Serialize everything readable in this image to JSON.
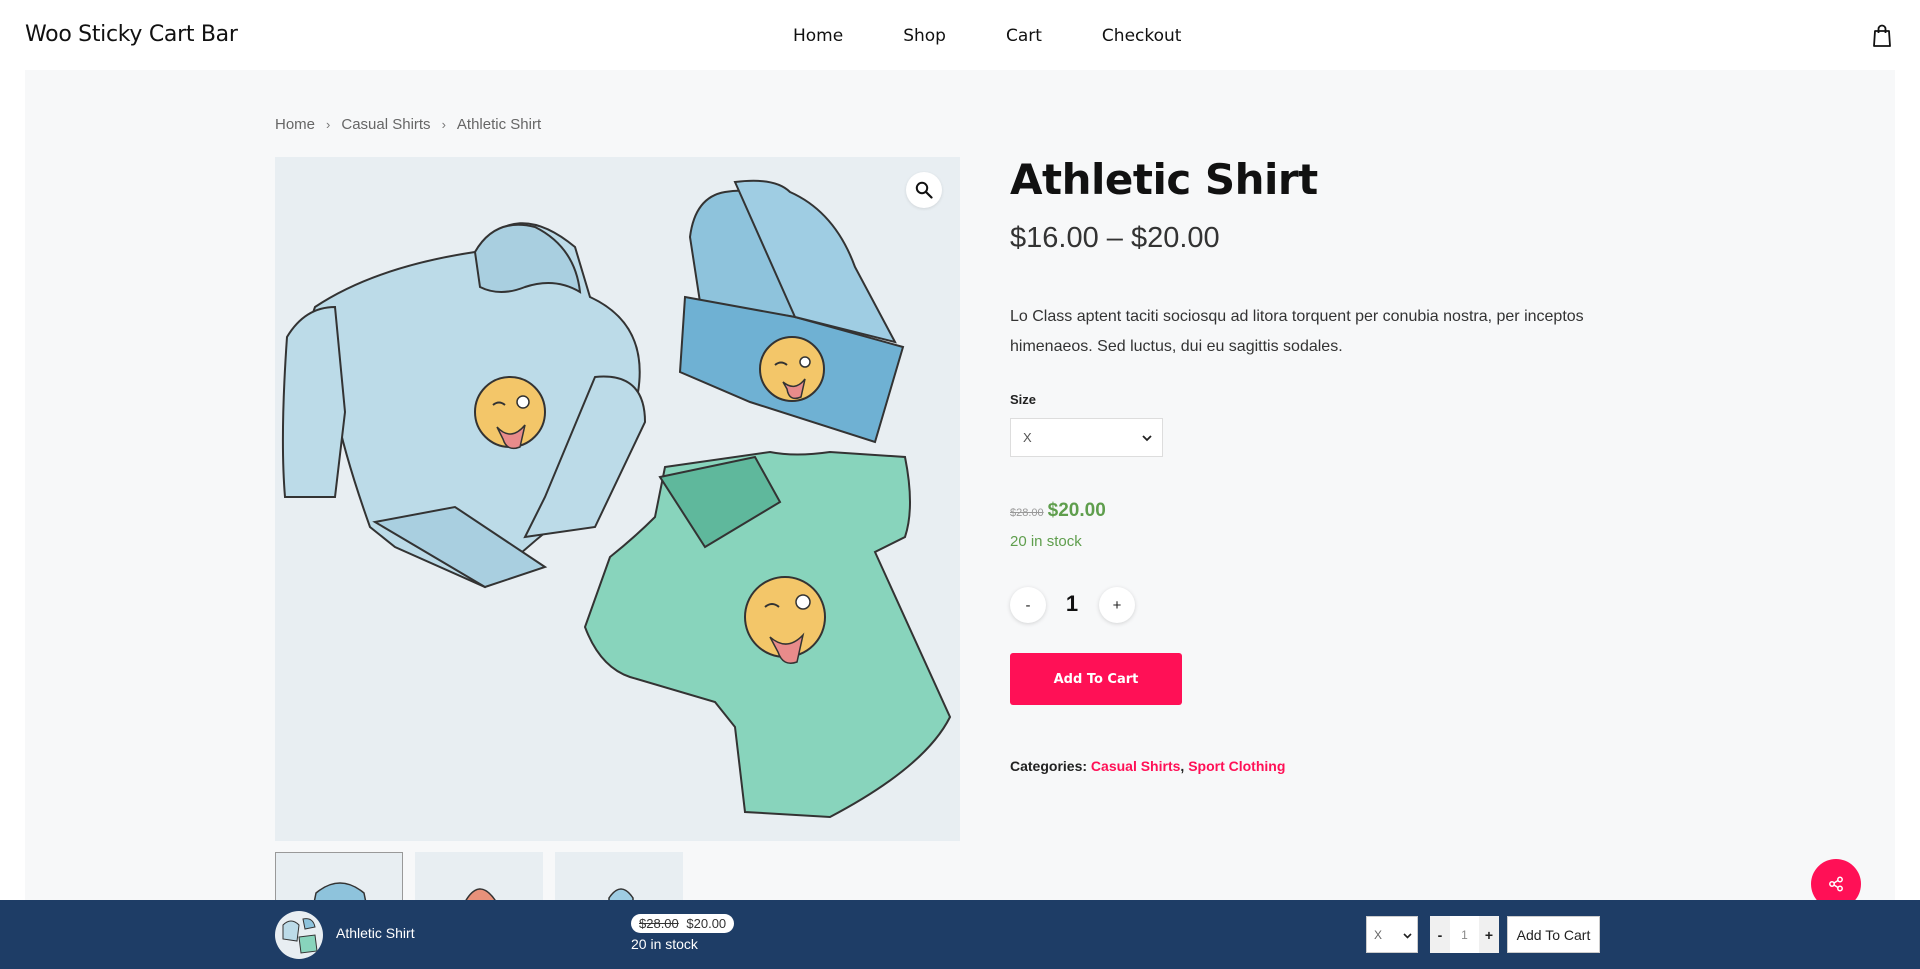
{
  "header": {
    "site_title": "Woo Sticky Cart Bar",
    "nav": [
      "Home",
      "Shop",
      "Cart",
      "Checkout"
    ],
    "cart_icon": "shopping-bag-icon"
  },
  "breadcrumb": [
    "Home",
    "Casual Shirts",
    "Athletic Shirt"
  ],
  "product": {
    "title": "Athletic Shirt",
    "price_range": "$16.00 – $20.00",
    "description": "Lo Class aptent taciti sociosqu ad litora torquent per conubia nostra, per inceptos himenaeos. Sed luctus, dui eu sagittis sodales.",
    "size_label": "Size",
    "size_value": "X",
    "variation_old_price": "$28.00",
    "variation_price": "$20.00",
    "stock": "20 in stock",
    "quantity": "1",
    "qty_minus": "-",
    "qty_plus": "+",
    "add_to_cart": "Add To Cart",
    "categories_label": "Categories:",
    "categories": [
      "Casual Shirts",
      "Sport Clothing"
    ],
    "categories_sep": ", "
  },
  "sticky_bar": {
    "name": "Athletic Shirt",
    "old_price": "$28.00",
    "price": "$20.00",
    "stock": "20 in stock",
    "size_value": "X",
    "qty_minus": "-",
    "quantity": "1",
    "qty_plus": "+",
    "add_to_cart": "Add To Cart"
  },
  "colors": {
    "accent": "#ff1056",
    "stock_green": "#5f9e4d",
    "sticky_bg": "#1e3d66"
  }
}
